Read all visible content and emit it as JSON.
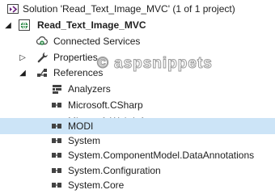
{
  "solution": {
    "label": "Solution 'Read_Text_Image_MVC' (1 of 1 project)",
    "icon": "solution-icon"
  },
  "project": {
    "label": "Read_Text_Image_MVC",
    "icon": "web-project-icon",
    "expanded": true
  },
  "tree": {
    "connected_services": {
      "label": "Connected Services",
      "icon": "connected-services-icon"
    },
    "properties": {
      "label": "Properties",
      "icon": "wrench-icon",
      "expanded": false
    },
    "references": {
      "label": "References",
      "icon": "references-icon",
      "expanded": true,
      "items": [
        {
          "label": "Analyzers",
          "icon": "analyzers-icon"
        },
        {
          "label": "Microsoft.CSharp",
          "icon": "assembly-reference-icon"
        },
        {
          "label": "Microsoft.Web.Infrastructure",
          "icon": "assembly-reference-icon"
        },
        {
          "label": "MODI",
          "icon": "assembly-reference-icon",
          "selected": true
        },
        {
          "label": "System",
          "icon": "assembly-reference-icon"
        },
        {
          "label": "System.ComponentModel.DataAnnotations",
          "icon": "assembly-reference-icon"
        },
        {
          "label": "System.Configuration",
          "icon": "assembly-reference-icon"
        },
        {
          "label": "System.Core",
          "icon": "assembly-reference-icon"
        }
      ]
    }
  },
  "watermark": {
    "text": "aspsnippets",
    "symbol": "©"
  },
  "colors": {
    "selection": "#cce4f7",
    "text": "#1e1e1e",
    "project_globe": "#1a7f37",
    "solution_purple": "#68217a"
  }
}
